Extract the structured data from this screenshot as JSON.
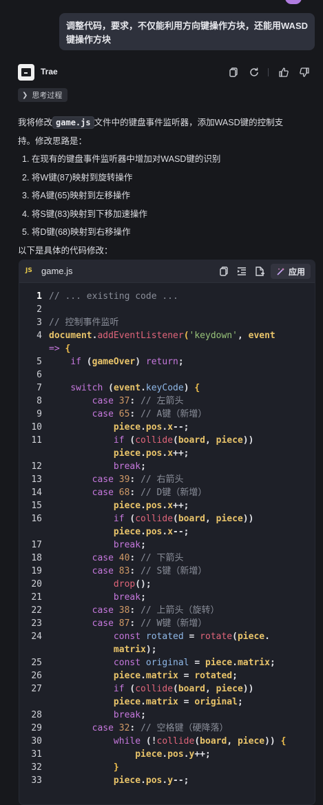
{
  "user_message": {
    "line1": "调整代码，要求，不仅能利用方向键操作方块，还能用WASD",
    "line2": "键操作方块"
  },
  "assistant": {
    "name": "Trae",
    "thinking_label": "思考过程",
    "intro_before_code": "我将修改",
    "intro_code": "game.js",
    "intro_after_code": "文件中的键盘事件监听器，添加WASD键的控制支",
    "intro_line2": "持。修改思路是：",
    "steps": [
      "1. 在现有的键盘事件监听器中增加对WASD键的识别",
      "2. 将W键(87)映射到旋转操作",
      "3. 将A键(65)映射到左移操作",
      "4. 将S键(83)映射到下移加速操作",
      "5. 将D键(68)映射到右移操作"
    ],
    "outro": "以下是具体的代码修改："
  },
  "code_block": {
    "lang_badge": "JS",
    "file_name": "game.js",
    "apply_label": "应用",
    "lines": [
      {
        "n": "1",
        "segs": [
          [
            "cm",
            "// ... existing code ..."
          ]
        ]
      },
      {
        "n": "2",
        "segs": []
      },
      {
        "n": "3",
        "segs": [
          [
            "cm",
            "// 控制事件监听"
          ]
        ]
      },
      {
        "n": "4",
        "segs": [
          [
            "id",
            "document"
          ],
          [
            "pn",
            "."
          ],
          [
            "fn",
            "addEventListener"
          ],
          [
            "br",
            "("
          ],
          [
            "str",
            "'keydown'"
          ],
          [
            "pn",
            ", "
          ],
          [
            "id",
            "event"
          ]
        ]
      },
      {
        "n": "",
        "segs": [
          [
            "kw",
            "=>"
          ],
          [
            "pn",
            " "
          ],
          [
            "br",
            "{"
          ]
        ]
      },
      {
        "n": "5",
        "segs": [
          [
            "pn",
            "    "
          ],
          [
            "kw",
            "if"
          ],
          [
            "pn",
            " ("
          ],
          [
            "id",
            "gameOver"
          ],
          [
            "pn",
            ") "
          ],
          [
            "kw",
            "return"
          ],
          [
            "pn",
            ";"
          ]
        ]
      },
      {
        "n": "6",
        "segs": []
      },
      {
        "n": "7",
        "segs": [
          [
            "pn",
            "    "
          ],
          [
            "kw",
            "switch"
          ],
          [
            "pn",
            " ("
          ],
          [
            "id",
            "event"
          ],
          [
            "pn",
            "."
          ],
          [
            "prop",
            "keyCode"
          ],
          [
            "pn",
            ") "
          ],
          [
            "br",
            "{"
          ]
        ]
      },
      {
        "n": "8",
        "segs": [
          [
            "pn",
            "        "
          ],
          [
            "kw",
            "case"
          ],
          [
            "pn",
            " "
          ],
          [
            "num",
            "37"
          ],
          [
            "pn",
            ": "
          ],
          [
            "cm",
            "// 左箭头"
          ]
        ]
      },
      {
        "n": "9",
        "segs": [
          [
            "pn",
            "        "
          ],
          [
            "kw",
            "case"
          ],
          [
            "pn",
            " "
          ],
          [
            "num",
            "65"
          ],
          [
            "pn",
            ": "
          ],
          [
            "cm",
            "// A键（新增）"
          ]
        ]
      },
      {
        "n": "10",
        "segs": [
          [
            "pn",
            "            "
          ],
          [
            "id",
            "piece"
          ],
          [
            "pn",
            "."
          ],
          [
            "id",
            "pos"
          ],
          [
            "pn",
            "."
          ],
          [
            "id",
            "x"
          ],
          [
            "pn",
            "--;"
          ]
        ]
      },
      {
        "n": "11",
        "segs": [
          [
            "pn",
            "            "
          ],
          [
            "kw",
            "if"
          ],
          [
            "pn",
            " ("
          ],
          [
            "fn",
            "collide"
          ],
          [
            "pn",
            "("
          ],
          [
            "id",
            "board"
          ],
          [
            "pn",
            ", "
          ],
          [
            "id",
            "piece"
          ],
          [
            "pn",
            "))"
          ]
        ]
      },
      {
        "n": "",
        "segs": [
          [
            "pn",
            "            "
          ],
          [
            "id",
            "piece"
          ],
          [
            "pn",
            "."
          ],
          [
            "id",
            "pos"
          ],
          [
            "pn",
            "."
          ],
          [
            "id",
            "x"
          ],
          [
            "pn",
            "++;"
          ]
        ]
      },
      {
        "n": "12",
        "segs": [
          [
            "pn",
            "            "
          ],
          [
            "kw",
            "break"
          ],
          [
            "pn",
            ";"
          ]
        ]
      },
      {
        "n": "13",
        "segs": [
          [
            "pn",
            "        "
          ],
          [
            "kw",
            "case"
          ],
          [
            "pn",
            " "
          ],
          [
            "num",
            "39"
          ],
          [
            "pn",
            ": "
          ],
          [
            "cm",
            "// 右箭头"
          ]
        ]
      },
      {
        "n": "14",
        "segs": [
          [
            "pn",
            "        "
          ],
          [
            "kw",
            "case"
          ],
          [
            "pn",
            " "
          ],
          [
            "num",
            "68"
          ],
          [
            "pn",
            ": "
          ],
          [
            "cm",
            "// D键（新增）"
          ]
        ]
      },
      {
        "n": "15",
        "segs": [
          [
            "pn",
            "            "
          ],
          [
            "id",
            "piece"
          ],
          [
            "pn",
            "."
          ],
          [
            "id",
            "pos"
          ],
          [
            "pn",
            "."
          ],
          [
            "id",
            "x"
          ],
          [
            "pn",
            "++;"
          ]
        ]
      },
      {
        "n": "16",
        "segs": [
          [
            "pn",
            "            "
          ],
          [
            "kw",
            "if"
          ],
          [
            "pn",
            " ("
          ],
          [
            "fn",
            "collide"
          ],
          [
            "pn",
            "("
          ],
          [
            "id",
            "board"
          ],
          [
            "pn",
            ", "
          ],
          [
            "id",
            "piece"
          ],
          [
            "pn",
            "))"
          ]
        ]
      },
      {
        "n": "",
        "segs": [
          [
            "pn",
            "            "
          ],
          [
            "id",
            "piece"
          ],
          [
            "pn",
            "."
          ],
          [
            "id",
            "pos"
          ],
          [
            "pn",
            "."
          ],
          [
            "id",
            "x"
          ],
          [
            "pn",
            "--;"
          ]
        ]
      },
      {
        "n": "17",
        "segs": [
          [
            "pn",
            "            "
          ],
          [
            "kw",
            "break"
          ],
          [
            "pn",
            ";"
          ]
        ]
      },
      {
        "n": "18",
        "segs": [
          [
            "pn",
            "        "
          ],
          [
            "kw",
            "case"
          ],
          [
            "pn",
            " "
          ],
          [
            "num",
            "40"
          ],
          [
            "pn",
            ": "
          ],
          [
            "cm",
            "// 下箭头"
          ]
        ]
      },
      {
        "n": "19",
        "segs": [
          [
            "pn",
            "        "
          ],
          [
            "kw",
            "case"
          ],
          [
            "pn",
            " "
          ],
          [
            "num",
            "83"
          ],
          [
            "pn",
            ": "
          ],
          [
            "cm",
            "// S键（新增）"
          ]
        ]
      },
      {
        "n": "20",
        "segs": [
          [
            "pn",
            "            "
          ],
          [
            "fn",
            "drop"
          ],
          [
            "pn",
            "();"
          ]
        ]
      },
      {
        "n": "21",
        "segs": [
          [
            "pn",
            "            "
          ],
          [
            "kw",
            "break"
          ],
          [
            "pn",
            ";"
          ]
        ]
      },
      {
        "n": "22",
        "segs": [
          [
            "pn",
            "        "
          ],
          [
            "kw",
            "case"
          ],
          [
            "pn",
            " "
          ],
          [
            "num",
            "38"
          ],
          [
            "pn",
            ": "
          ],
          [
            "cm",
            "// 上箭头（旋转）"
          ]
        ]
      },
      {
        "n": "23",
        "segs": [
          [
            "pn",
            "        "
          ],
          [
            "kw",
            "case"
          ],
          [
            "pn",
            " "
          ],
          [
            "num",
            "87"
          ],
          [
            "pn",
            ": "
          ],
          [
            "cm",
            "// W键（新增）"
          ]
        ]
      },
      {
        "n": "24",
        "segs": [
          [
            "pn",
            "            "
          ],
          [
            "kw",
            "const"
          ],
          [
            "pn",
            " "
          ],
          [
            "prop",
            "rotated"
          ],
          [
            "pn",
            " = "
          ],
          [
            "fn",
            "rotate"
          ],
          [
            "pn",
            "("
          ],
          [
            "id",
            "piece"
          ],
          [
            "pn",
            "."
          ]
        ]
      },
      {
        "n": "",
        "segs": [
          [
            "pn",
            "            "
          ],
          [
            "id",
            "matrix"
          ],
          [
            "pn",
            ");"
          ]
        ]
      },
      {
        "n": "25",
        "segs": [
          [
            "pn",
            "            "
          ],
          [
            "kw",
            "const"
          ],
          [
            "pn",
            " "
          ],
          [
            "prop",
            "original"
          ],
          [
            "pn",
            " = "
          ],
          [
            "id",
            "piece"
          ],
          [
            "pn",
            "."
          ],
          [
            "id",
            "matrix"
          ],
          [
            "pn",
            ";"
          ]
        ]
      },
      {
        "n": "26",
        "segs": [
          [
            "pn",
            "            "
          ],
          [
            "id",
            "piece"
          ],
          [
            "pn",
            "."
          ],
          [
            "id",
            "matrix"
          ],
          [
            "pn",
            " = "
          ],
          [
            "id",
            "rotated"
          ],
          [
            "pn",
            ";"
          ]
        ]
      },
      {
        "n": "27",
        "segs": [
          [
            "pn",
            "            "
          ],
          [
            "kw",
            "if"
          ],
          [
            "pn",
            " ("
          ],
          [
            "fn",
            "collide"
          ],
          [
            "pn",
            "("
          ],
          [
            "id",
            "board"
          ],
          [
            "pn",
            ", "
          ],
          [
            "id",
            "piece"
          ],
          [
            "pn",
            "))"
          ]
        ]
      },
      {
        "n": "",
        "segs": [
          [
            "pn",
            "            "
          ],
          [
            "id",
            "piece"
          ],
          [
            "pn",
            "."
          ],
          [
            "id",
            "matrix"
          ],
          [
            "pn",
            " = "
          ],
          [
            "id",
            "original"
          ],
          [
            "pn",
            ";"
          ]
        ]
      },
      {
        "n": "28",
        "segs": [
          [
            "pn",
            "            "
          ],
          [
            "kw",
            "break"
          ],
          [
            "pn",
            ";"
          ]
        ]
      },
      {
        "n": "29",
        "segs": [
          [
            "pn",
            "        "
          ],
          [
            "kw",
            "case"
          ],
          [
            "pn",
            " "
          ],
          [
            "num",
            "32"
          ],
          [
            "pn",
            ": "
          ],
          [
            "cm",
            "// 空格键（硬降落）"
          ]
        ]
      },
      {
        "n": "30",
        "segs": [
          [
            "pn",
            "            "
          ],
          [
            "kw",
            "while"
          ],
          [
            "pn",
            " (!"
          ],
          [
            "fn",
            "collide"
          ],
          [
            "pn",
            "("
          ],
          [
            "id",
            "board"
          ],
          [
            "pn",
            ", "
          ],
          [
            "id",
            "piece"
          ],
          [
            "pn",
            ")) "
          ],
          [
            "br",
            "{"
          ]
        ]
      },
      {
        "n": "31",
        "segs": [
          [
            "pn",
            "                "
          ],
          [
            "id",
            "piece"
          ],
          [
            "pn",
            "."
          ],
          [
            "id",
            "pos"
          ],
          [
            "pn",
            "."
          ],
          [
            "id",
            "y"
          ],
          [
            "pn",
            "++;"
          ]
        ]
      },
      {
        "n": "32",
        "segs": [
          [
            "pn",
            "            "
          ],
          [
            "br",
            "}"
          ]
        ]
      },
      {
        "n": "33",
        "segs": [
          [
            "pn",
            "            "
          ],
          [
            "id",
            "piece"
          ],
          [
            "pn",
            "."
          ],
          [
            "id",
            "pos"
          ],
          [
            "pn",
            "."
          ],
          [
            "id",
            "y"
          ],
          [
            "pn",
            "--;"
          ]
        ]
      }
    ]
  },
  "colors": {
    "background": "#17181c",
    "bubble": "#2e313c",
    "code_bg": "#1e2028",
    "keyword": "#c678dd",
    "function": "#e0657a",
    "string": "#98c379",
    "comment": "#8a8e99"
  },
  "icons": [
    "copy-icon",
    "refresh-icon",
    "thumbs-up-icon",
    "thumbs-down-icon",
    "chevron-right-icon",
    "insert-icon",
    "new-file-icon",
    "magic-wand-icon"
  ]
}
